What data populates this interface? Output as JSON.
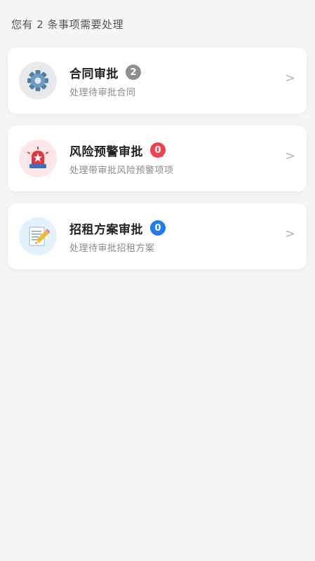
{
  "summary": {
    "text": "您有 2 条事项需要处理"
  },
  "items": [
    {
      "title": "合同审批",
      "badge": "2",
      "badge_color": "#8e8e93",
      "subtitle": "处理待审批合同",
      "icon": "gear-icon",
      "icon_bg": "#e9e9ec",
      "chevron": ">"
    },
    {
      "title": "风险预警审批",
      "badge": "0",
      "badge_color": "#f0424a",
      "subtitle": "处理带审批风险预警项项",
      "icon": "siren-icon",
      "icon_bg": "#fde6e7",
      "chevron": ">"
    },
    {
      "title": "招租方案审批",
      "badge": "0",
      "badge_color": "#1e7cf0",
      "subtitle": "处理待审批招租方案",
      "icon": "memo-pencil-icon",
      "icon_bg": "#e3f1fc",
      "chevron": ">"
    }
  ]
}
